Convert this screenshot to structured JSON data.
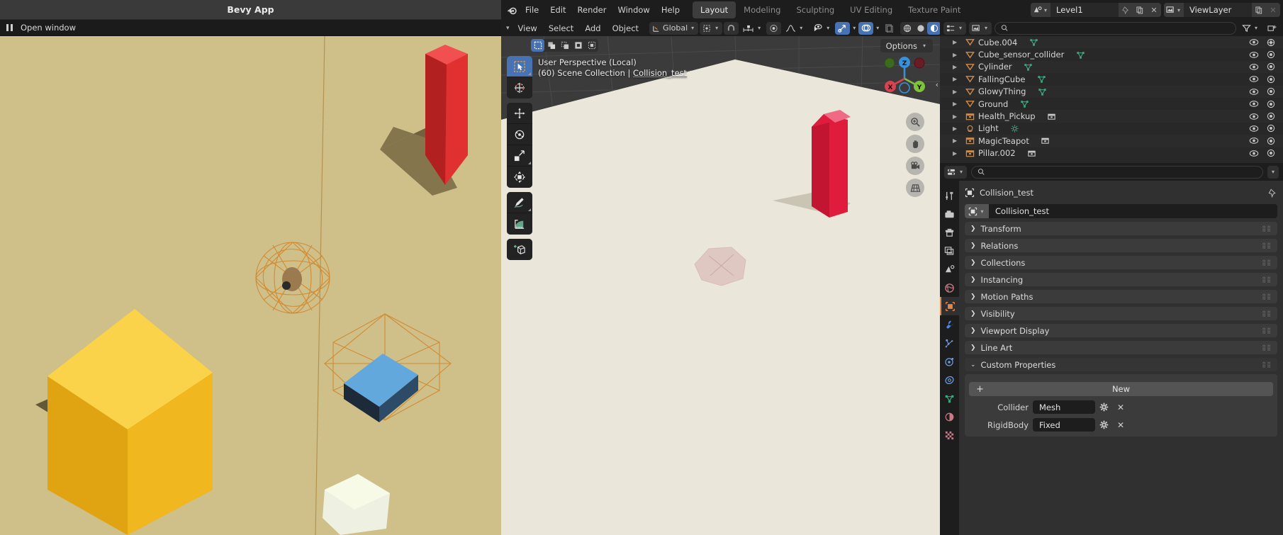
{
  "bevy": {
    "title": "Bevy App",
    "menu_label": "Open window",
    "pause_icon": "pause-icon"
  },
  "blender": {
    "topbar": {
      "logo_icon": "blender-logo-icon",
      "menus": [
        "File",
        "Edit",
        "Render",
        "Window",
        "Help"
      ],
      "workspaces": [
        {
          "label": "Layout",
          "active": true
        },
        {
          "label": "Modeling",
          "active": false
        },
        {
          "label": "Sculpting",
          "active": false
        },
        {
          "label": "UV Editing",
          "active": false
        },
        {
          "label": "Texture Paint",
          "active": false
        }
      ],
      "scene": {
        "icon": "scene-icon",
        "name": "Level1",
        "pin_icon": "pin-icon",
        "copy_icon": "copy-icon",
        "close_icon": "x-icon"
      },
      "viewlayer": {
        "icon": "viewlayer-icon",
        "name": "ViewLayer",
        "copy_icon": "copy-icon",
        "close_icon": "x-icon"
      }
    },
    "viewport_header": {
      "editor_icon": "editor-type-icon",
      "menus": [
        "View",
        "Select",
        "Add",
        "Object"
      ],
      "transform_orientation": {
        "icon": "orientation-icon",
        "value": "Global"
      },
      "snap_icon": "magnet-icon",
      "snap_target_icon": "snap-increment-icon",
      "proportional_icon": "proportional-edit-icon",
      "falloff_icon": "falloff-curve-icon",
      "visibility_icon": "eye-dropper-icon",
      "gizmo_icon": "gizmo-icon",
      "overlay_icon": "overlays-icon",
      "xray_icon": "xray-icon",
      "shading_modes": [
        "wireframe",
        "solid",
        "material-preview",
        "rendered"
      ],
      "shading_active": "material-preview"
    },
    "viewport": {
      "info_line1": "User Perspective (Local)",
      "info_line2_prefix": "(60) Scene Collection | ",
      "info_line2_selected": "Collision_test",
      "options_label": "Options",
      "toolbar": [
        {
          "name": "tweak-select-box-tool",
          "active": true
        },
        {
          "name": "cursor-tool",
          "active": false
        },
        {
          "name": "move-tool",
          "active": false
        },
        {
          "name": "rotate-tool",
          "active": false
        },
        {
          "name": "scale-tool",
          "active": false
        },
        {
          "name": "transform-tool",
          "active": false
        },
        {
          "name": "annotate-tool",
          "active": false
        },
        {
          "name": "measure-tool",
          "active": false
        },
        {
          "name": "add-cube-tool",
          "active": false
        }
      ],
      "select_modes": [
        "set",
        "extend",
        "subtract",
        "invert",
        "intersect"
      ],
      "gizmo_axes": [
        "X",
        "Y",
        "Z"
      ],
      "nav_buttons": [
        "zoom-icon",
        "pan-hand-icon",
        "camera-view-icon",
        "orthographic-toggle-icon"
      ]
    },
    "outliner": {
      "display_mode_icon": "outliner-display-mode-icon",
      "filter_icon": "filter-icon",
      "new_collection_icon": "new-collection-icon",
      "search_placeholder": "",
      "items": [
        {
          "name": "Cube.004",
          "type_icon": "mesh-object-icon",
          "data_icon": "mesh-data-icon",
          "visible": true,
          "renderable": true
        },
        {
          "name": "Cube_sensor_collider",
          "type_icon": "mesh-object-icon",
          "data_icon": "mesh-data-icon",
          "visible": true,
          "renderable": true
        },
        {
          "name": "Cylinder",
          "type_icon": "mesh-object-icon",
          "data_icon": "mesh-data-icon",
          "visible": true,
          "renderable": true
        },
        {
          "name": "FallingCube",
          "type_icon": "mesh-object-icon",
          "data_icon": "mesh-data-icon",
          "visible": true,
          "renderable": true
        },
        {
          "name": "GlowyThing",
          "type_icon": "mesh-object-icon",
          "data_icon": "mesh-data-icon",
          "visible": true,
          "renderable": true
        },
        {
          "name": "Ground",
          "type_icon": "mesh-object-icon",
          "data_icon": "mesh-data-icon",
          "visible": true,
          "renderable": true
        },
        {
          "name": "Health_Pickup",
          "type_icon": "collection-instance-icon",
          "data_icon": "collection-icon",
          "visible": true,
          "renderable": true
        },
        {
          "name": "Light",
          "type_icon": "light-object-icon",
          "data_icon": "light-data-icon",
          "visible": true,
          "renderable": true
        },
        {
          "name": "MagicTeapot",
          "type_icon": "collection-instance-icon",
          "data_icon": "collection-icon",
          "visible": true,
          "renderable": true
        },
        {
          "name": "Pillar.002",
          "type_icon": "collection-instance-icon",
          "data_icon": "collection-icon",
          "visible": true,
          "renderable": true
        }
      ]
    },
    "properties": {
      "editor_icon": "properties-editor-icon",
      "search_placeholder": "",
      "breadcrumb_icon": "object-properties-icon",
      "breadcrumb_name": "Collision_test",
      "pin_icon": "pin-icon",
      "id_block_icon": "object-icon",
      "id_block_name": "Collision_test",
      "tabs": [
        {
          "name": "tool-tab",
          "icon": "tool-icon",
          "active": false
        },
        {
          "name": "render-tab",
          "icon": "render-icon",
          "active": false
        },
        {
          "name": "output-tab",
          "icon": "printer-icon",
          "active": false
        },
        {
          "name": "viewlayer-tab",
          "icon": "images-icon",
          "active": false
        },
        {
          "name": "scene-tab",
          "icon": "scene-cone-icon",
          "active": false
        },
        {
          "name": "world-tab",
          "icon": "world-globe-icon",
          "active": false
        },
        {
          "name": "object-tab",
          "icon": "object-square-icon",
          "active": true
        },
        {
          "name": "modifier-tab",
          "icon": "wrench-icon",
          "active": false
        },
        {
          "name": "particles-tab",
          "icon": "particles-icon",
          "active": false
        },
        {
          "name": "physics-tab",
          "icon": "physics-orbit-icon",
          "active": false
        },
        {
          "name": "constraints-tab",
          "icon": "constraint-icon",
          "active": false
        },
        {
          "name": "data-tab",
          "icon": "mesh-data-icon",
          "active": false
        },
        {
          "name": "material-tab",
          "icon": "material-sphere-icon",
          "active": false
        },
        {
          "name": "texture-tab",
          "icon": "texture-checker-icon",
          "active": false
        }
      ],
      "panels": [
        {
          "label": "Transform",
          "open": false
        },
        {
          "label": "Relations",
          "open": false
        },
        {
          "label": "Collections",
          "open": false
        },
        {
          "label": "Instancing",
          "open": false
        },
        {
          "label": "Motion Paths",
          "open": false
        },
        {
          "label": "Visibility",
          "open": false
        },
        {
          "label": "Viewport Display",
          "open": false
        },
        {
          "label": "Line Art",
          "open": false
        },
        {
          "label": "Custom Properties",
          "open": true
        }
      ],
      "new_button_label": "New",
      "custom_properties": [
        {
          "label": "Collider",
          "value": "Mesh",
          "gear_icon": "gear-icon",
          "delete_icon": "x-icon"
        },
        {
          "label": "RigidBody",
          "value": "Fixed",
          "gear_icon": "gear-icon",
          "delete_icon": "x-icon"
        }
      ]
    },
    "colors": {
      "accent_blue": "#4772b3",
      "accent_orange": "#e8874a",
      "mesh_icon": "#d08b4a",
      "data_icon": "#3ca87e",
      "axis_x": "#d9434f",
      "axis_y": "#7fc33a",
      "axis_z": "#3a8fd9",
      "editor_bg": "#303030",
      "header_bg": "#1d1d1d",
      "outliner_bg": "#282828"
    }
  }
}
